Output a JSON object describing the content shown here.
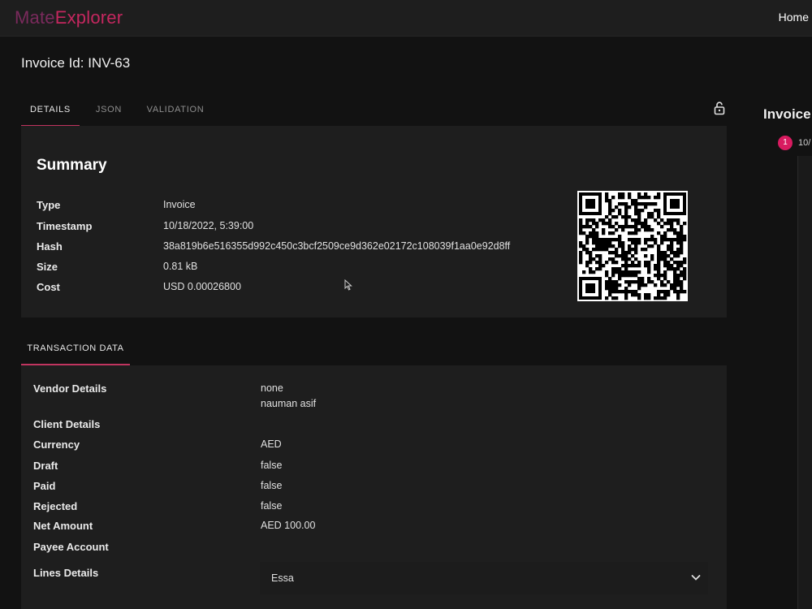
{
  "app": {
    "logo_part1": "Mate",
    "logo_part2": "Explorer",
    "nav_home": "Home"
  },
  "page": {
    "title": "Invoice Id: INV-63"
  },
  "tabs": [
    {
      "label": "DETAILS",
      "active": true
    },
    {
      "label": "JSON",
      "active": false
    },
    {
      "label": "VALIDATION",
      "active": false
    }
  ],
  "summary": {
    "title": "Summary",
    "rows": [
      {
        "key": "Type",
        "value": "Invoice"
      },
      {
        "key": "Timestamp",
        "value": "10/18/2022, 5:39:00"
      },
      {
        "key": "Hash",
        "value": "38a819b6e516355d992c450c3bcf2509ce9d362e02172c108039f1aa0e92d8ff"
      },
      {
        "key": "Size",
        "value": "0.81 kB"
      },
      {
        "key": "Cost",
        "value": "USD 0.00026800"
      }
    ]
  },
  "transaction": {
    "tab_label": "TRANSACTION DATA",
    "vendor_details": {
      "key": "Vendor Details",
      "line1": "none",
      "line2": "nauman asif"
    },
    "client_details": {
      "key": "Client Details",
      "value": ""
    },
    "currency": {
      "key": "Currency",
      "value": "AED"
    },
    "draft": {
      "key": "Draft",
      "value": "false"
    },
    "paid": {
      "key": "Paid",
      "value": "false"
    },
    "rejected": {
      "key": "Rejected",
      "value": "false"
    },
    "net_amount": {
      "key": "Net Amount",
      "value": "AED 100.00"
    },
    "payee_account": {
      "key": "Payee Account",
      "value": ""
    },
    "lines_details": {
      "key": "Lines Details",
      "item": "Essa"
    }
  },
  "right_panel": {
    "title": "Invoice",
    "step_number": "1",
    "step_text": "10/"
  },
  "icons": {
    "lock": "lock-icon",
    "chevron": "chevron-down-icon",
    "cursor": "cursor-icon"
  },
  "colors": {
    "accent": "#c0345f",
    "badge": "#d81b60",
    "panel": "#1e1e1e",
    "background": "#121212"
  }
}
